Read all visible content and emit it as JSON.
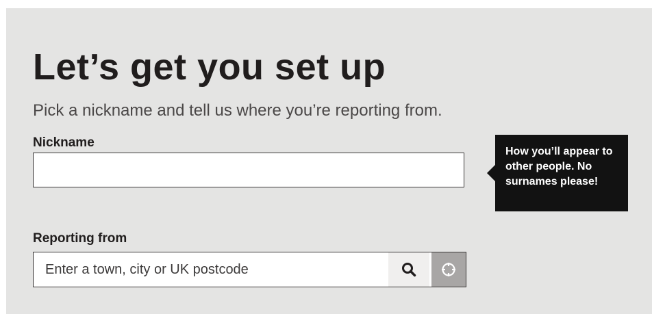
{
  "heading": "Let’s get you set up",
  "subtitle": "Pick a nickname and tell us where you’re reporting from.",
  "nickname": {
    "label": "Nickname",
    "value": "",
    "tooltip": "How you’ll appear to other people. No surnames please!"
  },
  "reporting": {
    "label": "Reporting from",
    "placeholder": "Enter a town, city or UK postcode",
    "search_icon": "search-icon",
    "locate_icon": "crosshair-icon"
  },
  "colors": {
    "panel_bg": "#e4e4e3",
    "tooltip_bg": "#121212",
    "locate_bg": "#a8a6a5"
  }
}
